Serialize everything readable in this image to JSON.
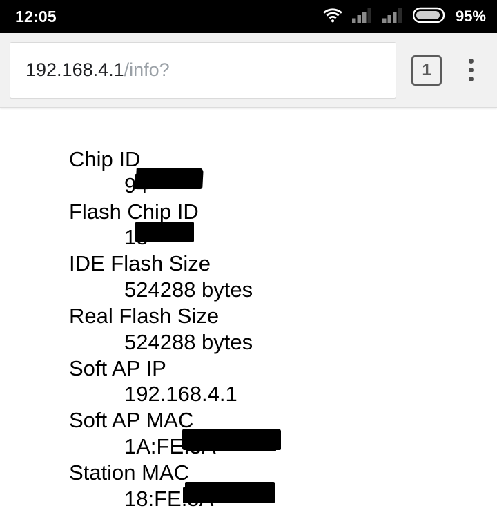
{
  "status_bar": {
    "time": "12:05",
    "battery_percent": "95%",
    "icons": [
      "wifi-icon",
      "signal-bars-icon",
      "signal-bars-icon",
      "battery-icon"
    ]
  },
  "browser": {
    "url_host": "192.168.4.1",
    "url_path": "/info?",
    "url_full": "192.168.4.1/info?",
    "tab_count": "1",
    "menu_icon": "overflow-menu-icon"
  },
  "page": {
    "entries": [
      {
        "label": "Chip ID",
        "value_prefix": "9",
        "value_suffix": "4",
        "redacted": true,
        "redaction_style": "chipid"
      },
      {
        "label": "Flash Chip ID",
        "value_prefix": "1",
        "value_suffix": "8",
        "redacted": true,
        "redaction_style": "flashid"
      },
      {
        "label": "IDE Flash Size",
        "value_prefix": "524288 bytes",
        "value_suffix": "",
        "redacted": false,
        "redaction_style": ""
      },
      {
        "label": "Real Flash Size",
        "value_prefix": "524288 bytes",
        "value_suffix": "",
        "redacted": false,
        "redaction_style": ""
      },
      {
        "label": "Soft AP IP",
        "value_prefix": "192.168.4.1",
        "value_suffix": "",
        "redacted": false,
        "redaction_style": ""
      },
      {
        "label": "Soft AP MAC",
        "value_prefix": "1A:FE:",
        "value_suffix": "5A",
        "redacted": true,
        "redaction_style": "apmac"
      },
      {
        "label": "Station MAC",
        "value_prefix": "18:FE:",
        "value_suffix": "5A",
        "redacted": true,
        "redaction_style": "stamac"
      }
    ]
  },
  "colors": {
    "status_bar_bg": "#000000",
    "toolbar_bg": "#f1f1f1",
    "page_bg": "#ffffff",
    "url_host_color": "#202124",
    "url_path_color": "#9aa0a6",
    "text_color": "#000000",
    "redaction_color": "#000000"
  }
}
